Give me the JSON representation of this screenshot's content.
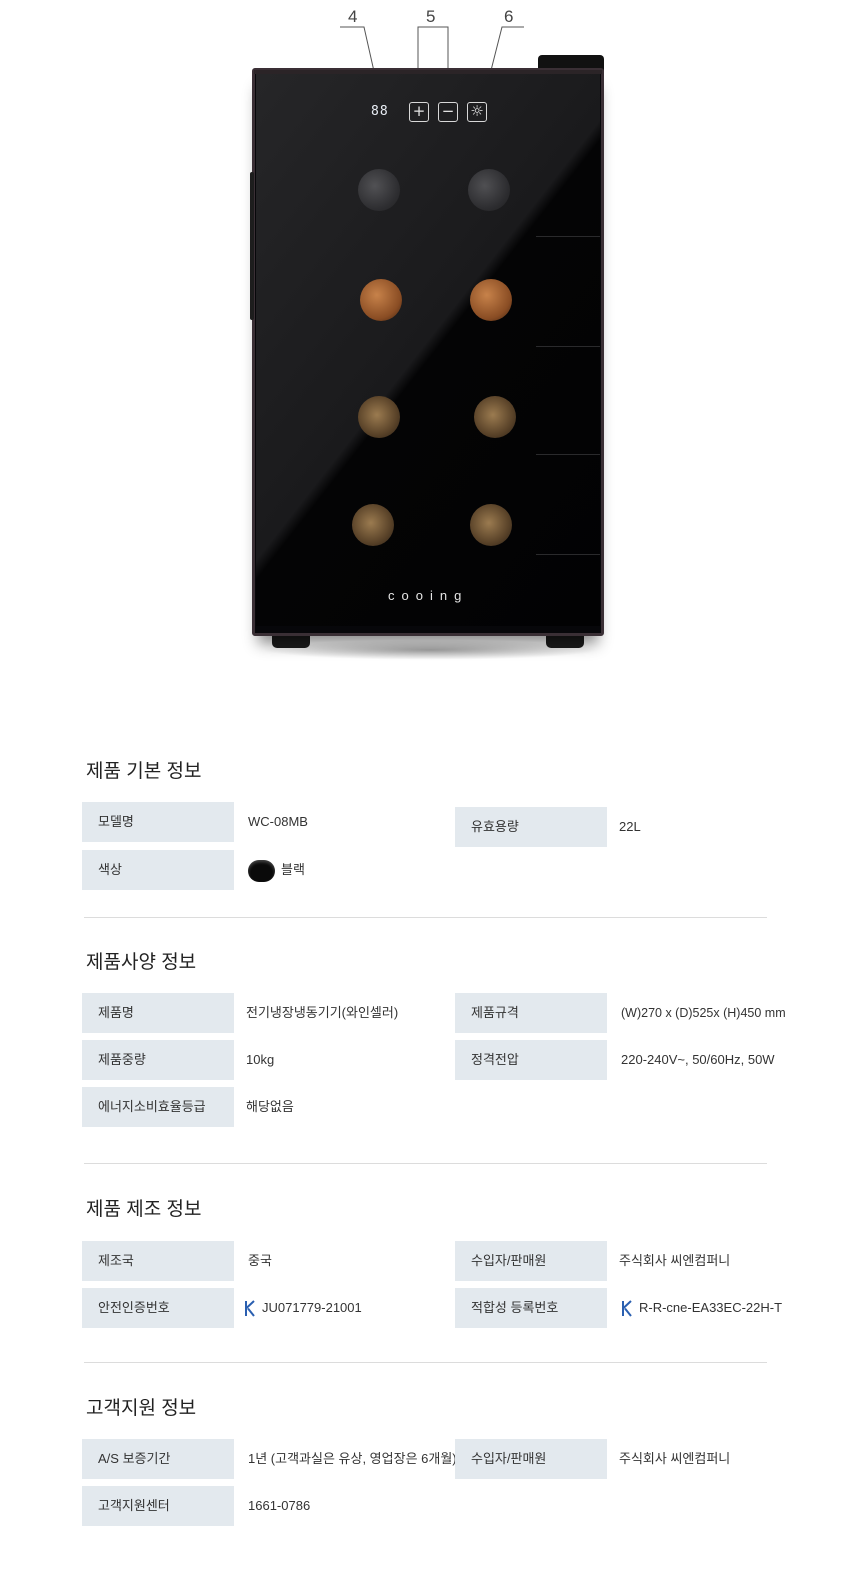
{
  "product": {
    "callouts": [
      "4",
      "5",
      "6"
    ],
    "display_text": "88",
    "buttons": [
      "+",
      "−",
      "☼"
    ],
    "brand": "cooing"
  },
  "sections": [
    {
      "title": "제품 기본 정보",
      "rows": [
        {
          "label": "모델명",
          "value": "WC-08MB"
        },
        {
          "label": "유효용량",
          "value": "22L"
        },
        {
          "label": "색상",
          "value": "블랙"
        }
      ]
    },
    {
      "title": "제품사양 정보",
      "rows": [
        {
          "label": "제품명",
          "value": "전기냉장냉동기기(와인셀러)"
        },
        {
          "label": "제품규격",
          "value": "(W)270 x (D)525x (H)450 mm"
        },
        {
          "label": "제품중량",
          "value": "10kg"
        },
        {
          "label": "정격전압",
          "value": "220-240V~, 50/60Hz, 50W"
        },
        {
          "label": "에너지소비효율등급",
          "value": "해당없음"
        }
      ]
    },
    {
      "title": "제품 제조 정보",
      "rows": [
        {
          "label": "제조국",
          "value": "중국"
        },
        {
          "label": "수입자/판매원",
          "value": "주식회사 씨엔컴퍼니"
        },
        {
          "label": "안전인증번호",
          "value": "JU071779-21001"
        },
        {
          "label": "적합성 등록번호",
          "value": "R-R-cne-EA33EC-22H-T"
        }
      ]
    },
    {
      "title": "고객지원 정보",
      "rows": [
        {
          "label": "A/S 보증기간",
          "value": "1년 (고객과실은 유상, 영업장은 6개월)"
        },
        {
          "label": "수입자/판매원",
          "value": "주식회사 씨엔컴퍼니"
        },
        {
          "label": "고객지원센터",
          "value": "1661-0786"
        }
      ]
    }
  ],
  "colors": {
    "label_bg": "#e3e9ee",
    "swatch": "#0a0a0a",
    "kc_icon": "#2a5fb0"
  },
  "icons": {
    "color_swatch": "black-color-swatch-icon",
    "certification": "kc-mark-icon"
  }
}
